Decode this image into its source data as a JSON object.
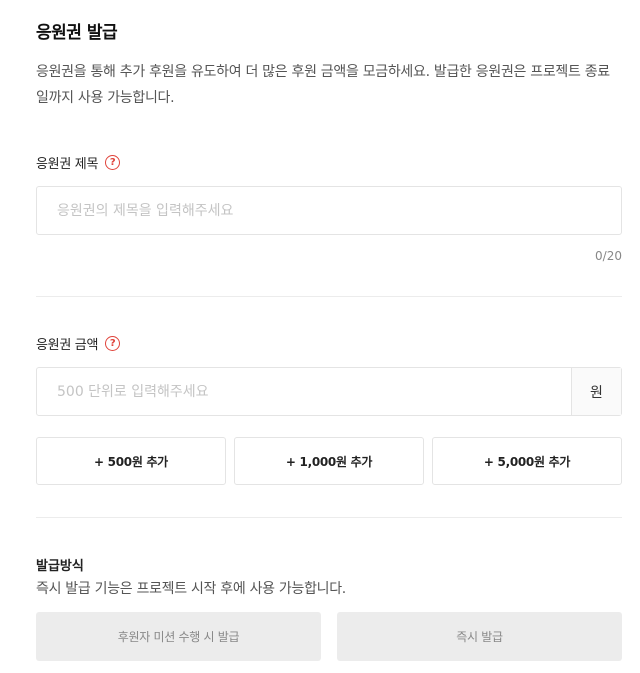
{
  "header": {
    "title": "응원권 발급",
    "description": "응원권을 통해 추가 후원을 유도하여 더 많은 후원 금액을 모금하세요. 발급한 응원권은 프로젝트 종료일까지 사용 가능합니다."
  },
  "voucher_title": {
    "label": "응원권 제목",
    "help_icon": "question-circle",
    "placeholder": "응원권의 제목을 입력해주세요",
    "value": "",
    "counter": "0/20"
  },
  "voucher_amount": {
    "label": "응원권 금액",
    "help_icon": "question-circle",
    "placeholder": "500 단위로 입력해주세요",
    "value": "",
    "unit": "원",
    "quick_add": [
      {
        "label": "+ 500원 추가"
      },
      {
        "label": "+ 1,000원 추가"
      },
      {
        "label": "+ 5,000원 추가"
      }
    ]
  },
  "issue_method": {
    "title": "발급방식",
    "description": "즉시 발급 기능은 프로젝트 시작 후에 사용 가능합니다.",
    "options": [
      {
        "label": "후원자 미션 수행 시 발급"
      },
      {
        "label": "즉시 발급"
      }
    ]
  },
  "colors": {
    "accent_red": "#e0443c",
    "border": "#e4e4e4",
    "disabled_bg": "#ececec"
  }
}
